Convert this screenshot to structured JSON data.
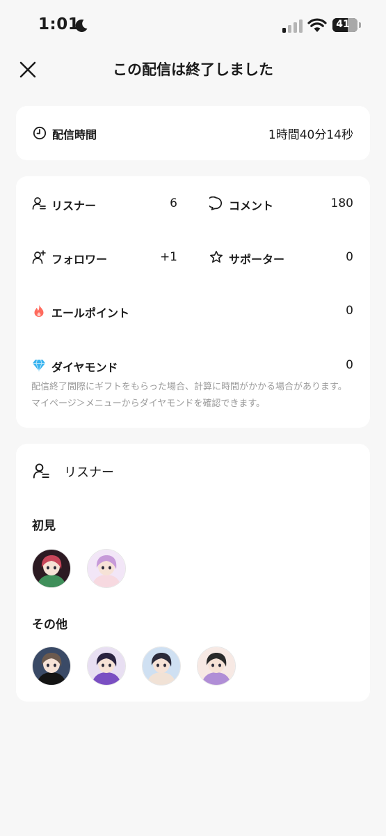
{
  "status_bar": {
    "time": "1:01",
    "battery": "41",
    "battery_fraction": 0.41,
    "icons": [
      "moon-icon",
      "cellular-signal-icon",
      "wifi-icon",
      "battery-icon"
    ]
  },
  "header": {
    "title": "この配信は終了しました",
    "close_icon": "close-icon"
  },
  "duration": {
    "label": "配信時間",
    "value": "1時間40分14秒",
    "icon": "clock-icon"
  },
  "stats": {
    "listeners": {
      "label": "リスナー",
      "value": "6",
      "icon": "listener-icon"
    },
    "comments": {
      "label": "コメント",
      "value": "180",
      "icon": "comment-icon"
    },
    "followers": {
      "label": "フォロワー",
      "value": "+1",
      "icon": "follower-add-icon"
    },
    "supporters": {
      "label": "サポーター",
      "value": "0",
      "icon": "star-icon"
    },
    "yell_points": {
      "label": "エールポイント",
      "value": "0",
      "icon": "flame-icon",
      "color": "#ff6b5e"
    },
    "diamonds": {
      "label": "ダイヤモンド",
      "value": "0",
      "icon": "diamond-icon",
      "color": "#39b4f0"
    },
    "note": "配信終了間際にギフトをもらった場合、計算に時間がかかる場合があります。マイページ＞メニューからダイヤモンドを確認できます。"
  },
  "listeners_section": {
    "title": "リスナー",
    "icon": "listener-icon",
    "groups": [
      {
        "heading": "初見",
        "avatars": [
          {
            "name": "avatar-first-1",
            "colors": [
              "#2c1a22",
              "#c8465a",
              "#3f8f5a"
            ]
          },
          {
            "name": "avatar-first-2",
            "colors": [
              "#f2e6f7",
              "#c79ad9",
              "#f7d9e0"
            ]
          }
        ]
      },
      {
        "heading": "その他",
        "avatars": [
          {
            "name": "avatar-other-1",
            "colors": [
              "#3a4a66",
              "#6c5a4e",
              "#141414"
            ]
          },
          {
            "name": "avatar-other-2",
            "colors": [
              "#e8dff2",
              "#2a2340",
              "#7a4fc2"
            ]
          },
          {
            "name": "avatar-other-3",
            "colors": [
              "#cfe0f2",
              "#2a2a3a",
              "#f1e2d6"
            ]
          },
          {
            "name": "avatar-other-4",
            "colors": [
              "#f7e9e4",
              "#2a2a2a",
              "#b08ed6"
            ]
          }
        ]
      }
    ]
  }
}
